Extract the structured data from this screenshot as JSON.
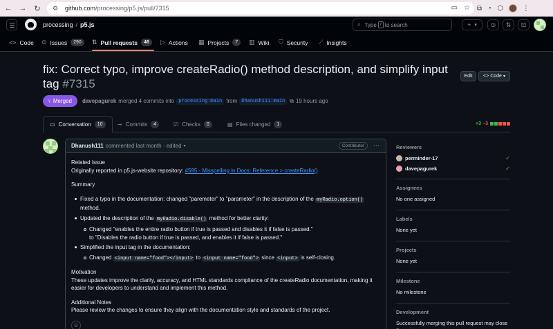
{
  "browser": {
    "url_host": "github.com",
    "url_path": "/processing/p5.js/pull/7315"
  },
  "header": {
    "owner": "processing",
    "separator": "/",
    "repo": "p5.js",
    "search_type": "Type",
    "search_key": "/",
    "search_rest": "to search",
    "plus": "+",
    "caret": "▾"
  },
  "repo_tabs": [
    {
      "label": "Code",
      "icon": "code-icon"
    },
    {
      "label": "Issues",
      "count": "290",
      "icon": "issue-icon"
    },
    {
      "label": "Pull requests",
      "count": "46",
      "icon": "pull-request-icon"
    },
    {
      "label": "Actions",
      "icon": "play-icon"
    },
    {
      "label": "Projects",
      "count": "7",
      "icon": "table-icon"
    },
    {
      "label": "Wiki",
      "icon": "book-icon"
    },
    {
      "label": "Security",
      "icon": "shield-icon"
    },
    {
      "label": "Insights",
      "icon": "graph-icon"
    }
  ],
  "pr": {
    "title": "fix: Correct typo, improve createRadio() method description, and simplify input tag",
    "number": "#7315",
    "edit_label": "Edit",
    "code_label": "Code",
    "status": "Merged",
    "author": "davepagurek",
    "merge_text": "merged 4 commits into",
    "base_branch": "processing:main",
    "from_text": "from",
    "head_branch": "Dhanush111:main",
    "time": "19 hours ago"
  },
  "pr_tabs": [
    {
      "label": "Conversation",
      "count": "10"
    },
    {
      "label": "Commits",
      "count": "4"
    },
    {
      "label": "Checks",
      "count": "0"
    },
    {
      "label": "Files changed",
      "count": "1"
    }
  ],
  "diffstat": {
    "additions": "+3",
    "deletions": "−3"
  },
  "comment": {
    "author": "Dhanush111",
    "meta": "commented last month · edited",
    "role": "Contributor",
    "related_heading": "Related Issue",
    "related_text": "Originally reported in p5.js-website repository: ",
    "related_link": "#595 - Misspelling in Docs: Reference > createRadio()",
    "summary_heading": "Summary",
    "bullet1_a": "Fixed a typo in the documentation: changed \"paremeter\" to \"parameter\" in the description of the ",
    "bullet1_code": "myRadio.option()",
    "bullet1_b": " method.",
    "bullet2_a": "Updated the description of the ",
    "bullet2_code": "myRadio.disable()",
    "bullet2_b": " method for better clarity:",
    "bullet2_sub": "Changed \"enables the entire radio button if true is passed and disables it if false is passed.\"",
    "bullet2_sub2": "to \"Disables the radio button if true is passed, and enables it if false is passed.\"",
    "bullet3": "Simplified the input tag in the documentation:",
    "bullet3_sub_a": "Changed ",
    "bullet3_code1": "<input name=\"food\"></input>",
    "bullet3_sub_b": " to ",
    "bullet3_code2": "<input name=\"food\">",
    "bullet3_sub_c": " since ",
    "bullet3_code3": "<input>",
    "bullet3_sub_d": " is self-closing.",
    "motivation_heading": "Motivation",
    "motivation_text": "These updates improve the clarity, accuracy, and HTML standards compliance of the createRadio documentation, making it easier for developers to understand and implement this method.",
    "notes_heading": "Additional Notes",
    "notes_text": "Please review the changes to ensure they align with the documentation style and standards of the project."
  },
  "sidebar": {
    "reviewers_title": "Reviewers",
    "reviewers": [
      {
        "name": "perminder-17"
      },
      {
        "name": "davepagurek"
      }
    ],
    "assignees_title": "Assignees",
    "assignees_value": "No one assigned",
    "labels_title": "Labels",
    "labels_value": "None yet",
    "projects_title": "Projects",
    "projects_value": "None yet",
    "milestone_title": "Milestone",
    "milestone_value": "No milestone",
    "development_title": "Development",
    "development_value": "Successfully merging this pull request may close these issues."
  },
  "colors": {
    "merged": "#8957e5",
    "accent_link": "#4493f8",
    "success": "#3fb950",
    "danger": "#f85149",
    "tab_underline": "#f78166"
  }
}
